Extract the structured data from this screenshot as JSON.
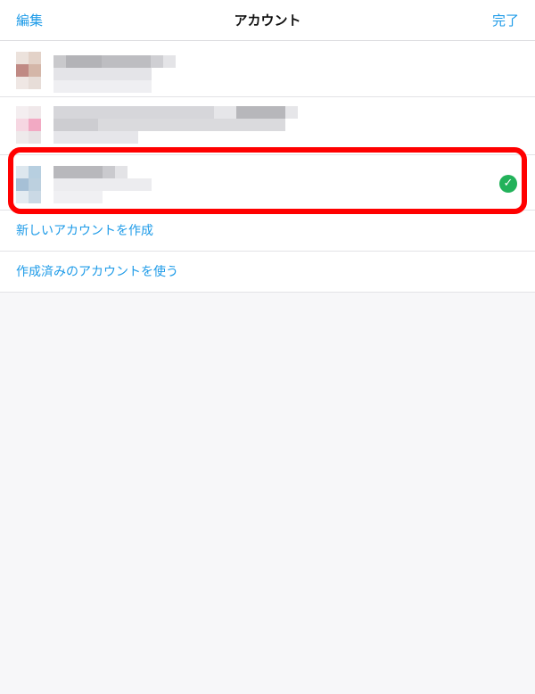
{
  "navbar": {
    "edit_label": "編集",
    "title": "アカウント",
    "done_label": "完了"
  },
  "accounts": [
    {
      "selected": false
    },
    {
      "selected": false
    },
    {
      "selected": true
    }
  ],
  "actions": {
    "create_new_account": "新しいアカウントを作成",
    "use_existing_account": "作成済みのアカウントを使う"
  },
  "colors": {
    "accent": "#1e9be8",
    "check": "#22b25a",
    "highlight": "#ff0000"
  }
}
